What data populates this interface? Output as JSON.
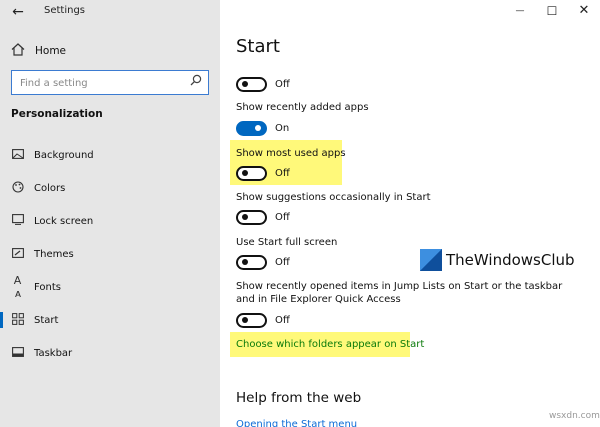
{
  "window": {
    "title": "Settings",
    "back_icon": "back-arrow-icon"
  },
  "window_controls": {
    "minimize": "—",
    "maximize": "☐",
    "close": "✕"
  },
  "sidebar": {
    "home_label": "Home",
    "search": {
      "placeholder": "Find a setting"
    },
    "section_title": "Personalization",
    "items": [
      {
        "label": "Background",
        "icon": "picture-icon",
        "active": false
      },
      {
        "label": "Colors",
        "icon": "palette-icon",
        "active": false
      },
      {
        "label": "Lock screen",
        "icon": "lock-screen-icon",
        "active": false
      },
      {
        "label": "Themes",
        "icon": "brush-icon",
        "active": false
      },
      {
        "label": "Fonts",
        "icon": "font-icon",
        "active": false
      },
      {
        "label": "Start",
        "icon": "start-icon",
        "active": true
      },
      {
        "label": "Taskbar",
        "icon": "taskbar-icon",
        "active": false
      }
    ]
  },
  "main": {
    "title": "Start",
    "settings": [
      {
        "label": "",
        "state": "Off",
        "on": false
      },
      {
        "label": "Show recently added apps",
        "state": "On",
        "on": true
      },
      {
        "label": "Show most used apps",
        "state": "Off",
        "on": false,
        "highlighted": true
      },
      {
        "label": "Show suggestions occasionally in Start",
        "state": "Off",
        "on": false
      },
      {
        "label": "Use Start full screen",
        "state": "Off",
        "on": false
      },
      {
        "label": "Show recently opened items in Jump Lists on Start or the taskbar and in File Explorer Quick Access",
        "state": "Off",
        "on": false
      }
    ],
    "folders_link": "Choose which folders appear on Start",
    "help_heading": "Help from the web",
    "help_link": "Opening the Start menu"
  },
  "watermark": {
    "text": "TheWindowsClub",
    "corner": "wsxdn.com"
  },
  "colors": {
    "accent": "#0067c0",
    "highlight": "#fff97a",
    "sidebar_bg": "#e6e6e6",
    "link": "#0a7a0a"
  }
}
